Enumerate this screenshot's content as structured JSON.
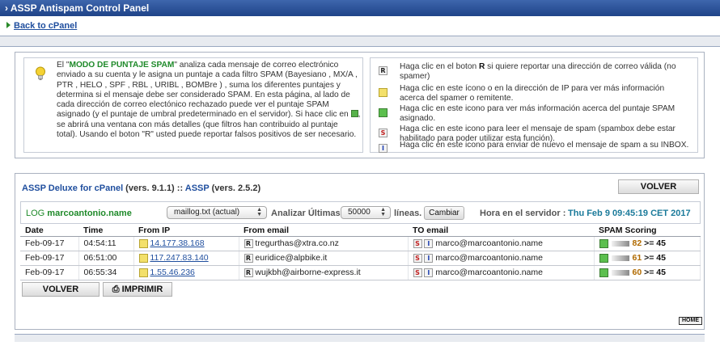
{
  "window": {
    "title": "ASSP Antispam Control Panel"
  },
  "nav": {
    "back_label": "Back to cPanel"
  },
  "info": {
    "p1_a": "El \"",
    "p1_mode": "MODO DE PUNTAJE SPAM",
    "p1_b": "\" analiza cada mensaje de correo electrónico enviado a su cuenta y le asigna un puntaje a cada filtro SPAM (Bayesiano , MX/A , PTR , HELO , SPF , RBL , URIBL , BOMBre ) , suma los diferentes puntajes y determina si el mensaje debe ser considerado SPAM. En esta página, al lado de cada dirección de correo electónico  rechazado puede ver el puntaje SPAM asignado (y el puntaje de umbral predeterminado en el servidor). Si hace clic en ",
    "p1_c": ", se abrirá una ventana con más detalles (que filtros han contribuido al puntaje total). Usando el boton \"R\" usted puede reportar falsos positivos de ser necesario."
  },
  "legend": [
    {
      "icon": "R",
      "icon_name": "report-icon",
      "text_a": "Haga clic en el boton ",
      "text_b": "R",
      "text_c": " si quiere reportar una dirección de correo válida (no spamer)"
    },
    {
      "icon": "",
      "icon_name": "ip-info-icon",
      "text_a": "Haga clic en este ícono o en la dirección de IP para ver más información acerca del spamer o remitente.",
      "text_b": "",
      "text_c": ""
    },
    {
      "icon": "",
      "icon_name": "score-details-icon",
      "text_a": "Haga clic en este icono para ver más información acerca del puntaje SPAM asignado.",
      "text_b": "",
      "text_c": ""
    },
    {
      "icon": "S",
      "icon_name": "spambox-icon",
      "text_a": "Haga clic en este icono para leer el mensaje de spam (spambox debe estar habilitado para poder utilizar esta función).",
      "text_b": "",
      "text_c": ""
    },
    {
      "icon": "I",
      "icon_name": "inbox-icon",
      "text_a": "Haga clic en este icono para enviar de nuevo el mensaje de spam a su INBOX.",
      "text_b": "",
      "text_c": ""
    }
  ],
  "panel": {
    "product": "ASSP Deluxe for cPanel",
    "version1": " (vers. 9.1.1) :: ",
    "assp": "ASSP",
    "version2": " (vers. 2.5.2)",
    "volver_top": "VOLVER",
    "volver_bottom": "VOLVER",
    "imprimir": "IMPRIMIR"
  },
  "log": {
    "label": "LOG",
    "user": "marcoantonio.name",
    "file_select": "maillog.txt (actual)",
    "analyze_label": "Analizar Últimas",
    "lines_select": "50000",
    "lines_label": "líneas.",
    "change_button": "Cambiar",
    "server_time_label": "Hora en el servidor :",
    "server_time": "Thu Feb 9 09:45:19 CET 2017"
  },
  "table": {
    "headers": [
      "Date",
      "Time",
      "From IP",
      "From email",
      "TO email",
      "SPAM Scoring"
    ],
    "rows": [
      {
        "date": "Feb-09-17",
        "time": "04:54:11",
        "ip": "14.177.38.168",
        "from": "tregurthas@xtra.co.nz",
        "to": "marco@marcoantonio.name",
        "score": "82",
        "threshold": ">= 45"
      },
      {
        "date": "Feb-09-17",
        "time": "06:51:00",
        "ip": "117.247.83.140",
        "from": "euridice@alpbike.it",
        "to": "marco@marcoantonio.name",
        "score": "61",
        "threshold": ">= 45"
      },
      {
        "date": "Feb-09-17",
        "time": "06:55:34",
        "ip": "1.55.46.236",
        "from": "wujkbh@airborne-express.it",
        "to": "marco@marcoantonio.name",
        "score": "60",
        "threshold": ">= 45"
      }
    ]
  },
  "footer": {
    "home_label": "HOME"
  },
  "colors": {
    "titlebar": "#2b5199",
    "accent_green": "#1f8a2a",
    "link": "#1f4e9e",
    "server_time": "#1a7a9a"
  }
}
